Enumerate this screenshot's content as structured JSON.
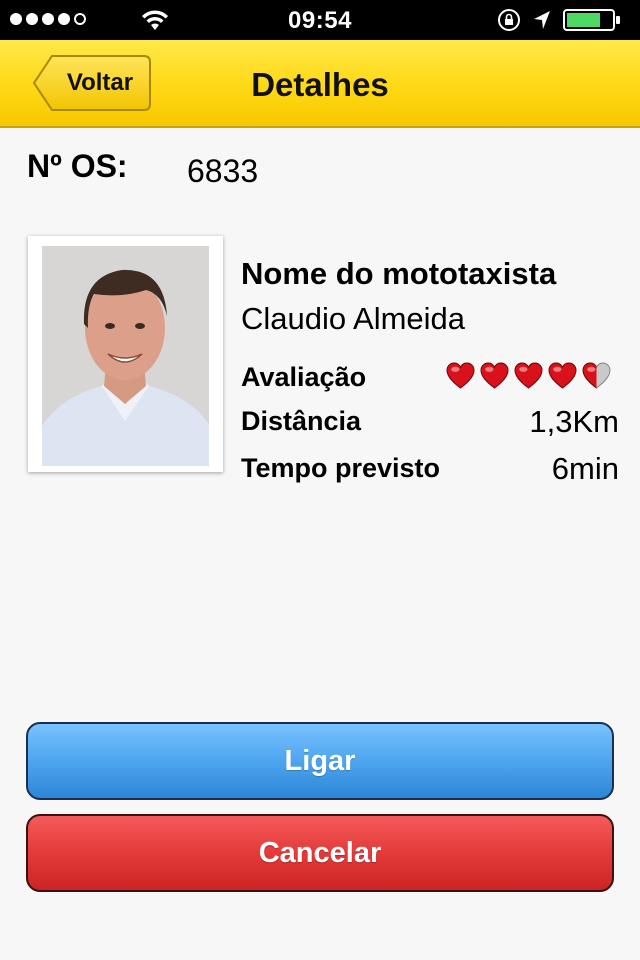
{
  "status_bar": {
    "time": "09:54",
    "signal_dots_filled": 4,
    "signal_dots_total": 5,
    "battery_level": 0.75,
    "icons": [
      "wifi-icon",
      "orientation-lock-icon",
      "location-arrow-icon",
      "battery-icon"
    ]
  },
  "nav": {
    "back_label": "Voltar",
    "title": "Detalhes"
  },
  "order": {
    "label": "Nº OS:",
    "value": "6833"
  },
  "driver": {
    "section_title": "Nome do mototaxista",
    "name": "Claudio Almeida",
    "rating_label": "Avaliação",
    "rating": 4.5,
    "rating_max": 5,
    "distance_label": "Distância",
    "distance": "1,3Km",
    "time_label": "Tempo previsto",
    "time": "6min"
  },
  "actions": {
    "call_label": "Ligar",
    "cancel_label": "Cancelar"
  },
  "colors": {
    "nav_yellow": "#ffd814",
    "call_blue": "#4ea5ef",
    "cancel_red": "#e43a3a",
    "heart_red": "#d8111a"
  }
}
